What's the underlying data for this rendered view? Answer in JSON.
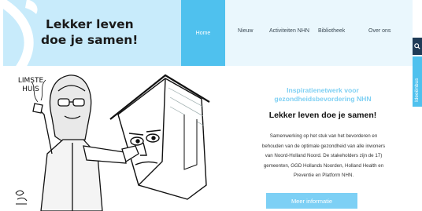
{
  "logo": {
    "line1": "Lekker leven",
    "line2": "doe je samen!"
  },
  "nav": {
    "items": [
      "Home",
      "Nieuw",
      "Activiteiten NHN",
      "Bibliotheek",
      "Over ons"
    ],
    "active": "Home"
  },
  "side_tab": {
    "label": "Ideeënbus"
  },
  "cartoon": {
    "label_line1": "LIMSTE",
    "label_line2": "HUIS",
    "signature": "BOS"
  },
  "hero": {
    "subtitle_line1": "Inspiratienetwerk voor",
    "subtitle_line2": "gezondheidsbevordering NHN",
    "title": "Lekker leven doe je samen!",
    "body_lines": [
      "Samenwerking op het stuk van het bevorderen en",
      "behouden van de optimale gezondheid van alle inwoners",
      "van Noord-Holland Noord. De stakeholders zijn de 17)",
      "gemeenten, GGD Hollands Noorden, Holland Health en",
      "Preventie en Platform NHN."
    ],
    "cta": "Meer informatie"
  },
  "colors": {
    "accent": "#4fc1ee",
    "logo_bg": "#c8ebfb",
    "nav_bg": "#eaf7fd",
    "dark": "#1f3b57",
    "button": "#7dd0f5",
    "subtitle": "#7fd0f3"
  }
}
